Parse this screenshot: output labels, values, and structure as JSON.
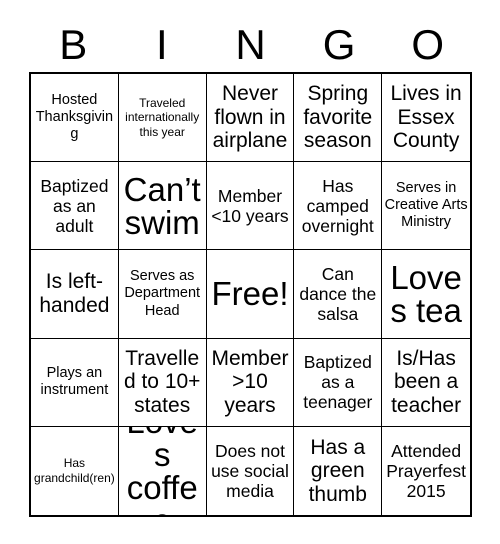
{
  "header": {
    "letters": [
      "B",
      "I",
      "N",
      "G",
      "O"
    ]
  },
  "grid": {
    "columns": 5,
    "rows": 5,
    "free_space_index": 12,
    "cells": [
      {
        "text": "Hosted Thanksgiving",
        "size": "sm"
      },
      {
        "text": "Traveled internationally this year",
        "size": "xs"
      },
      {
        "text": "Never flown in airplane",
        "size": "lg"
      },
      {
        "text": "Spring favorite season",
        "size": "lg"
      },
      {
        "text": "Lives in Essex County",
        "size": "lg"
      },
      {
        "text": "Baptized as an adult",
        "size": "md"
      },
      {
        "text": "Can’t swim",
        "size": "xxl"
      },
      {
        "text": "Member <10 years",
        "size": "md"
      },
      {
        "text": "Has camped overnight",
        "size": "md"
      },
      {
        "text": "Serves in Creative Arts Ministry",
        "size": "sm"
      },
      {
        "text": "Is left-handed",
        "size": "lg"
      },
      {
        "text": "Serves as Department Head",
        "size": "sm"
      },
      {
        "text": "Free!",
        "size": "xxl"
      },
      {
        "text": "Can dance the salsa",
        "size": "md"
      },
      {
        "text": "Loves tea",
        "size": "xxl"
      },
      {
        "text": "Plays an instrument",
        "size": "sm"
      },
      {
        "text": "Travelled to 10+ states",
        "size": "lg"
      },
      {
        "text": "Member >10 years",
        "size": "lg"
      },
      {
        "text": "Baptized as a teenager",
        "size": "md"
      },
      {
        "text": "Is/Has been a teacher",
        "size": "lg"
      },
      {
        "text": "Has grandchild(ren)",
        "size": "xs"
      },
      {
        "text": "Loves coffee",
        "size": "xxl"
      },
      {
        "text": "Does not use social media",
        "size": "md"
      },
      {
        "text": "Has a green thumb",
        "size": "lg"
      },
      {
        "text": "Attended Prayerfest 2015",
        "size": "md"
      }
    ]
  },
  "colors": {
    "background": "#ffffff",
    "text": "#000000",
    "border": "#000000"
  }
}
